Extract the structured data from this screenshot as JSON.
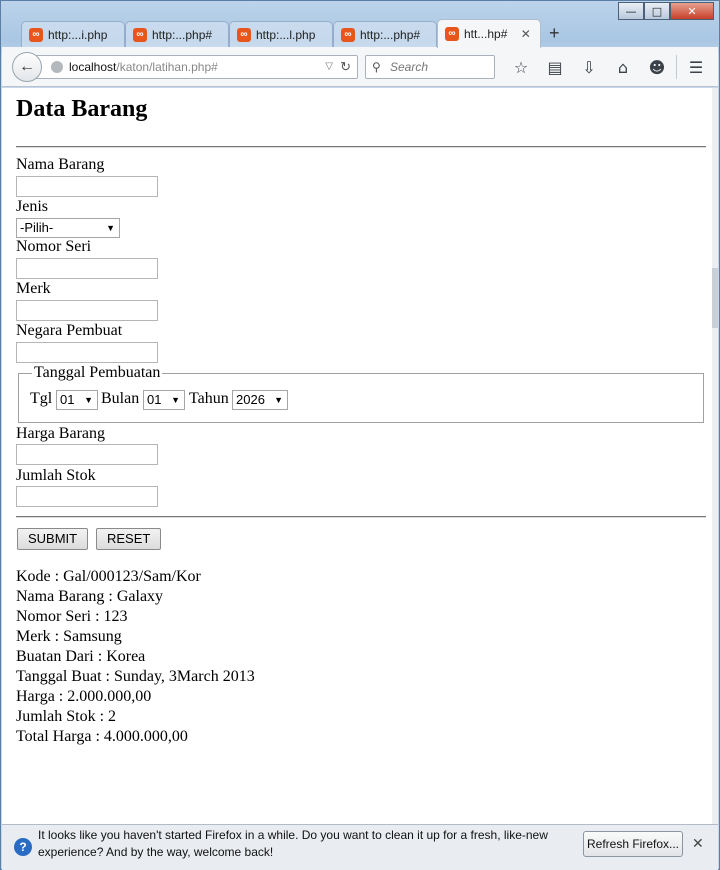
{
  "browser": {
    "tabs": [
      {
        "label": "http:...i.php",
        "active": false
      },
      {
        "label": "http:...php#",
        "active": false
      },
      {
        "label": "http:...l.php",
        "active": false
      },
      {
        "label": "http:...php#",
        "active": false
      },
      {
        "label": "htt...hp#",
        "active": true
      }
    ],
    "url_host": "localhost",
    "url_path": "/katon/latihan.php#",
    "search_placeholder": "Search"
  },
  "page": {
    "title": "Data Barang",
    "form": {
      "nama_barang_label": "Nama Barang",
      "jenis_label": "Jenis",
      "jenis_selected": "-Pilih-",
      "nomor_seri_label": "Nomor Seri",
      "merk_label": "Merk",
      "negara_label": "Negara Pembuat",
      "tanggal_legend": "Tanggal Pembuatan",
      "tgl_label": "Tgl",
      "tgl_selected": "01",
      "bulan_label": "Bulan",
      "bulan_selected": "01",
      "tahun_label": "Tahun",
      "tahun_selected": "2026",
      "harga_label": "Harga Barang",
      "stok_label": "Jumlah Stok",
      "submit_label": "SUBMIT",
      "reset_label": "RESET"
    },
    "result": [
      "Kode : Gal/000123/Sam/Kor",
      "Nama Barang : Galaxy",
      "Nomor Seri : 123",
      "Merk : Samsung",
      "Buatan Dari : Korea",
      "Tanggal Buat : Sunday, 3March 2013",
      "Harga : 2.000.000,00",
      "Jumlah Stok : 2",
      "Total Harga : 4.000.000,00"
    ]
  },
  "notification": {
    "message": "It looks like you haven't started Firefox in a while. Do you want to clean it up for a fresh, like-new experience? And by the way, welcome back!",
    "button_label": "Refresh Firefox..."
  },
  "colors": {
    "tab_icon": "#e8561e",
    "window_frame": "#a9c6e3"
  }
}
